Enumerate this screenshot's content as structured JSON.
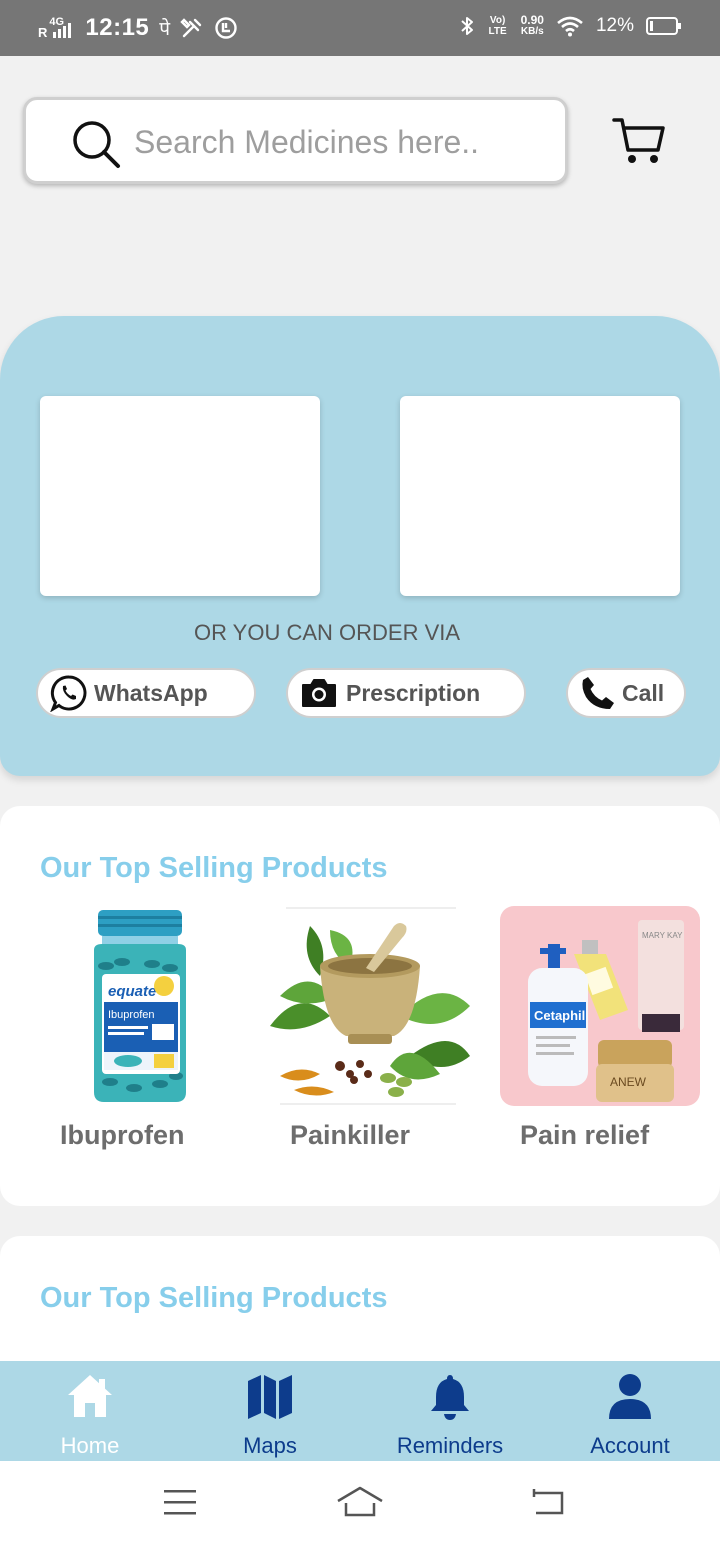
{
  "status_bar": {
    "network": "R",
    "network_type": "4G",
    "time": "12:15",
    "indicator_char": "पे",
    "lte_label": "Vo) LTE",
    "speed_value": "0.90",
    "speed_unit": "KB/s",
    "battery": "12%"
  },
  "search": {
    "placeholder": "Search Medicines here.."
  },
  "order_panel": {
    "or_text": "OR YOU CAN ORDER VIA",
    "buttons": [
      "WhatsApp",
      "Prescription",
      "Call"
    ]
  },
  "sections": [
    {
      "title": "Our Top Selling Products",
      "products": [
        {
          "name": "Ibuprofen"
        },
        {
          "name": "Painkiller"
        },
        {
          "name": "Pain relief"
        }
      ]
    },
    {
      "title": "Our Top Selling Products"
    }
  ],
  "bottom_nav": [
    {
      "label": "Home",
      "icon": "home-icon",
      "active": true
    },
    {
      "label": "Maps",
      "icon": "map-icon"
    },
    {
      "label": "Reminders",
      "icon": "bell-icon"
    },
    {
      "label": "Account",
      "icon": "user-icon"
    }
  ],
  "image_text": {
    "ibuprofen_brand": "equate",
    "ibuprofen_label": "Ibuprofen",
    "cetaphil_brand": "Cetaphil",
    "marykay_brand": "MARY KAY",
    "anew_brand": "ANEW"
  },
  "colors": {
    "status_bar": "#767676",
    "panel": "#add8e6",
    "section_title": "#87ceeb",
    "nav_icon": "#0d3c8c"
  }
}
